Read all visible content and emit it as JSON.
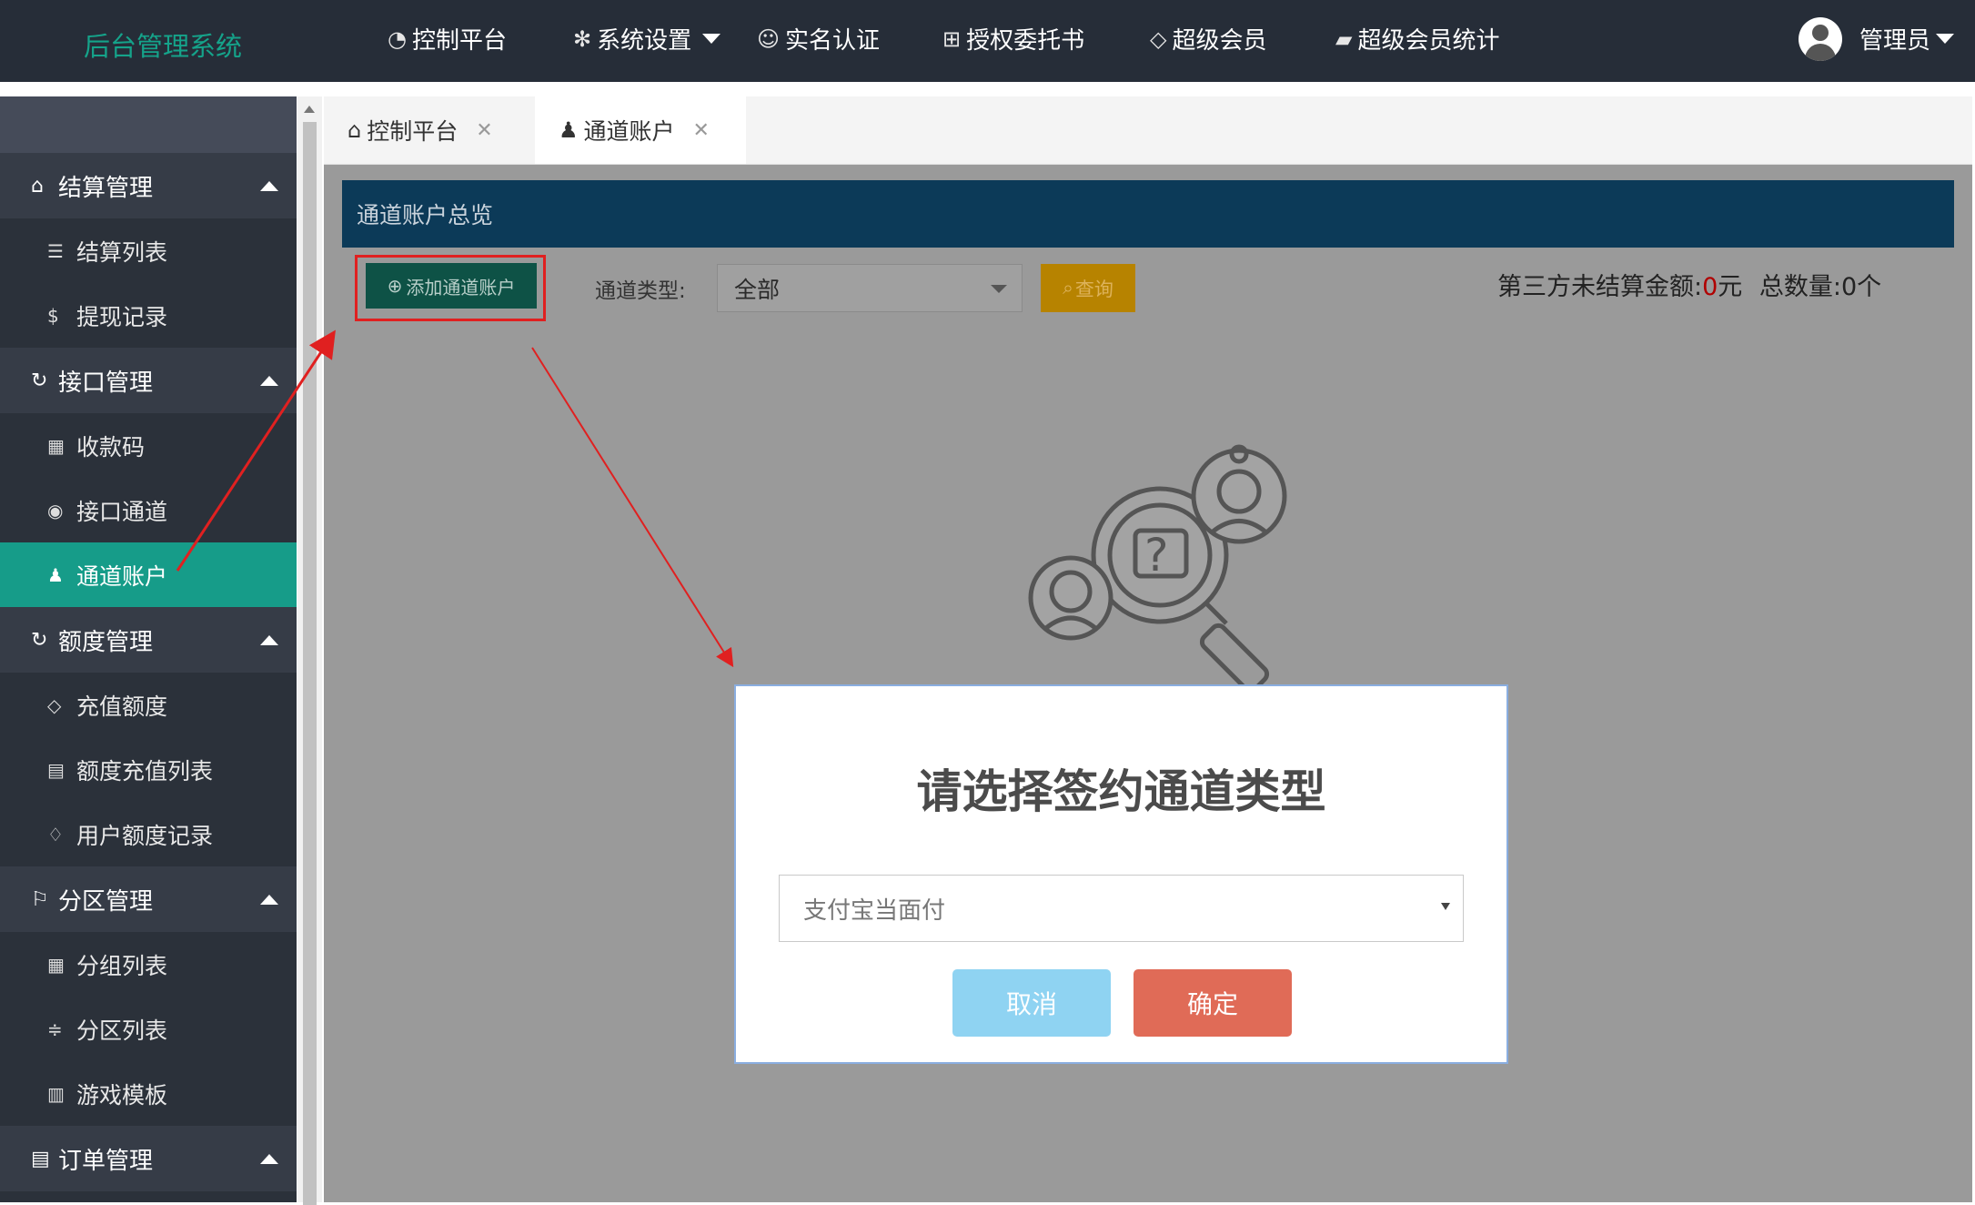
{
  "header": {
    "brand": "后台管理系统",
    "nav": [
      {
        "label": "控制平台",
        "icon": "dashboard-icon"
      },
      {
        "label": "系统设置",
        "icon": "gear-icon",
        "dropdown": true
      },
      {
        "label": "实名认证",
        "icon": "smile-icon"
      },
      {
        "label": "授权委托书",
        "icon": "book-icon"
      },
      {
        "label": "超级会员",
        "icon": "diamond-icon"
      },
      {
        "label": "超级会员统计",
        "icon": "chart-icon"
      }
    ],
    "user": "管理员"
  },
  "sidebar": {
    "groups": [
      {
        "label": "结算管理",
        "icon": "tag-icon",
        "items": [
          {
            "label": "结算列表",
            "icon": "list-icon"
          },
          {
            "label": "提现记录",
            "icon": "dollar-icon"
          }
        ]
      },
      {
        "label": "接口管理",
        "icon": "refresh-icon",
        "items": [
          {
            "label": "收款码",
            "icon": "grid-icon"
          },
          {
            "label": "接口通道",
            "icon": "palette-icon"
          },
          {
            "label": "通道账户",
            "icon": "user-icon",
            "active": true
          }
        ]
      },
      {
        "label": "额度管理",
        "icon": "refresh-icon",
        "items": [
          {
            "label": "充值额度",
            "icon": "diamond-icon"
          },
          {
            "label": "额度充值列表",
            "icon": "clipboard-icon"
          },
          {
            "label": "用户额度记录",
            "icon": "drops-icon"
          }
        ]
      },
      {
        "label": "分区管理",
        "icon": "flag-icon",
        "items": [
          {
            "label": "分组列表",
            "icon": "grid-icon"
          },
          {
            "label": "分区列表",
            "icon": "sliders-icon"
          },
          {
            "label": "游戏模板",
            "icon": "template-icon"
          }
        ]
      },
      {
        "label": "订单管理",
        "icon": "clipboard-icon",
        "items": []
      }
    ]
  },
  "tabs": [
    {
      "label": "控制平台",
      "icon": "home-icon"
    },
    {
      "label": "通道账户",
      "icon": "user-icon",
      "active": true
    }
  ],
  "main": {
    "panel_title": "通道账户总览",
    "add_button": "添加通道账户",
    "filter_label": "通道类型:",
    "filter_value": "全部",
    "query_button": "查询",
    "summary_prefix": "第三方未结算金额:",
    "summary_amount": "0",
    "summary_unit": "元",
    "summary_count_label": "总数量:",
    "summary_count": "0个"
  },
  "modal": {
    "title": "请选择签约通道类型",
    "select_value": "支付宝当面付",
    "cancel": "取消",
    "confirm": "确定"
  },
  "colors": {
    "topbar": "#262d38",
    "brand": "#15a38a",
    "sidebar_active": "#169c89",
    "panel_head": "#0c3a58",
    "cancel": "#8fd3f2",
    "confirm": "#e06b57",
    "annotation": "#e02020"
  }
}
